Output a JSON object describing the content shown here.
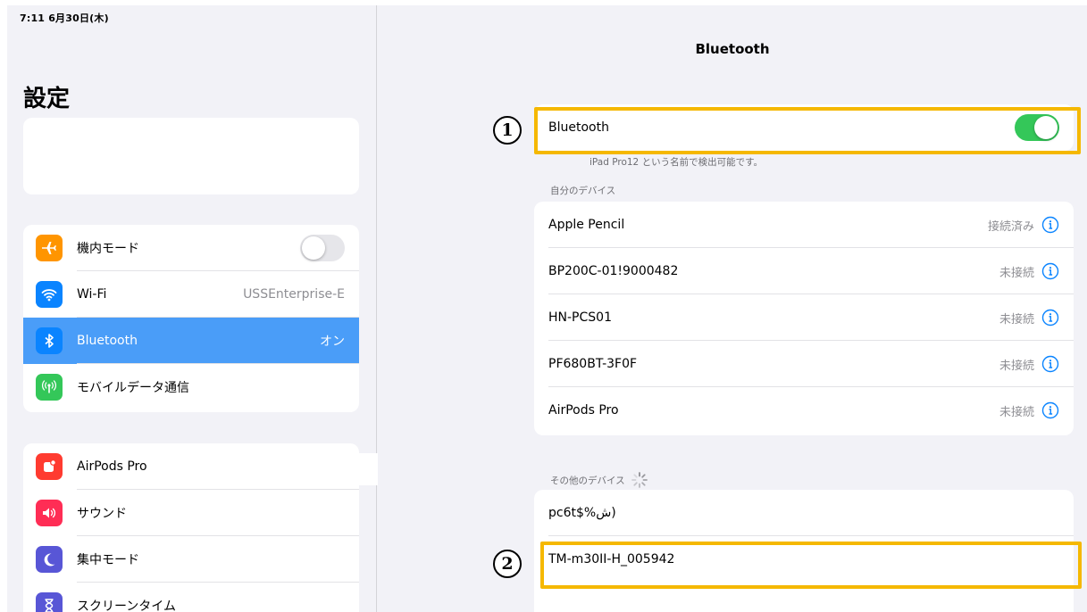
{
  "status_bar": {
    "time": "7:11  6月30日(木)"
  },
  "sidebar": {
    "title": "設定",
    "group1": [
      {
        "label": "機内モード",
        "icon": "airplane-icon",
        "color": "#ff9500",
        "toggle": false
      },
      {
        "label": "Wi-Fi",
        "icon": "wifi-icon",
        "color": "#0a84ff",
        "value": "USSEnterprise-E"
      },
      {
        "label": "Bluetooth",
        "icon": "bluetooth-icon",
        "color": "#0a84ff",
        "value": "オン",
        "selected": true
      },
      {
        "label": "モバイルデータ通信",
        "icon": "antenna-icon",
        "color": "#34c759"
      }
    ],
    "group2": [
      {
        "label": "AirPods Pro",
        "icon": "notifications-icon",
        "color": "#ff3b30"
      },
      {
        "label": "サウンド",
        "icon": "speaker-icon",
        "color": "#ff2d55"
      },
      {
        "label": "集中モード",
        "icon": "moon-icon",
        "color": "#5856d6"
      },
      {
        "label": "スクリーンタイム",
        "icon": "hourglass-icon",
        "color": "#5856d6"
      }
    ]
  },
  "detail": {
    "nav_title": "Bluetooth",
    "bluetooth_toggle": {
      "label": "Bluetooth",
      "on": true
    },
    "discoverable_note": "iPad Pro12 という名前で検出可能です。",
    "my_devices_header": "自分のデバイス",
    "my_devices": [
      {
        "name": "Apple Pencil",
        "status": "接続済み"
      },
      {
        "name": "BP200C-01!9000482",
        "status": "未接続"
      },
      {
        "name": "HN-PCS01",
        "status": "未接続"
      },
      {
        "name": "PF680BT-3F0F",
        "status": "未接続"
      },
      {
        "name": "AirPods Pro",
        "status": "未接続"
      }
    ],
    "other_devices_header": "その他のデバイス",
    "other_devices": [
      {
        "name": "pc6t$%ش)"
      },
      {
        "name": "TM-m30II-H_005942"
      }
    ]
  },
  "annotations": {
    "step1": "1",
    "step2": "2",
    "highlight_color": "#f5b800"
  }
}
